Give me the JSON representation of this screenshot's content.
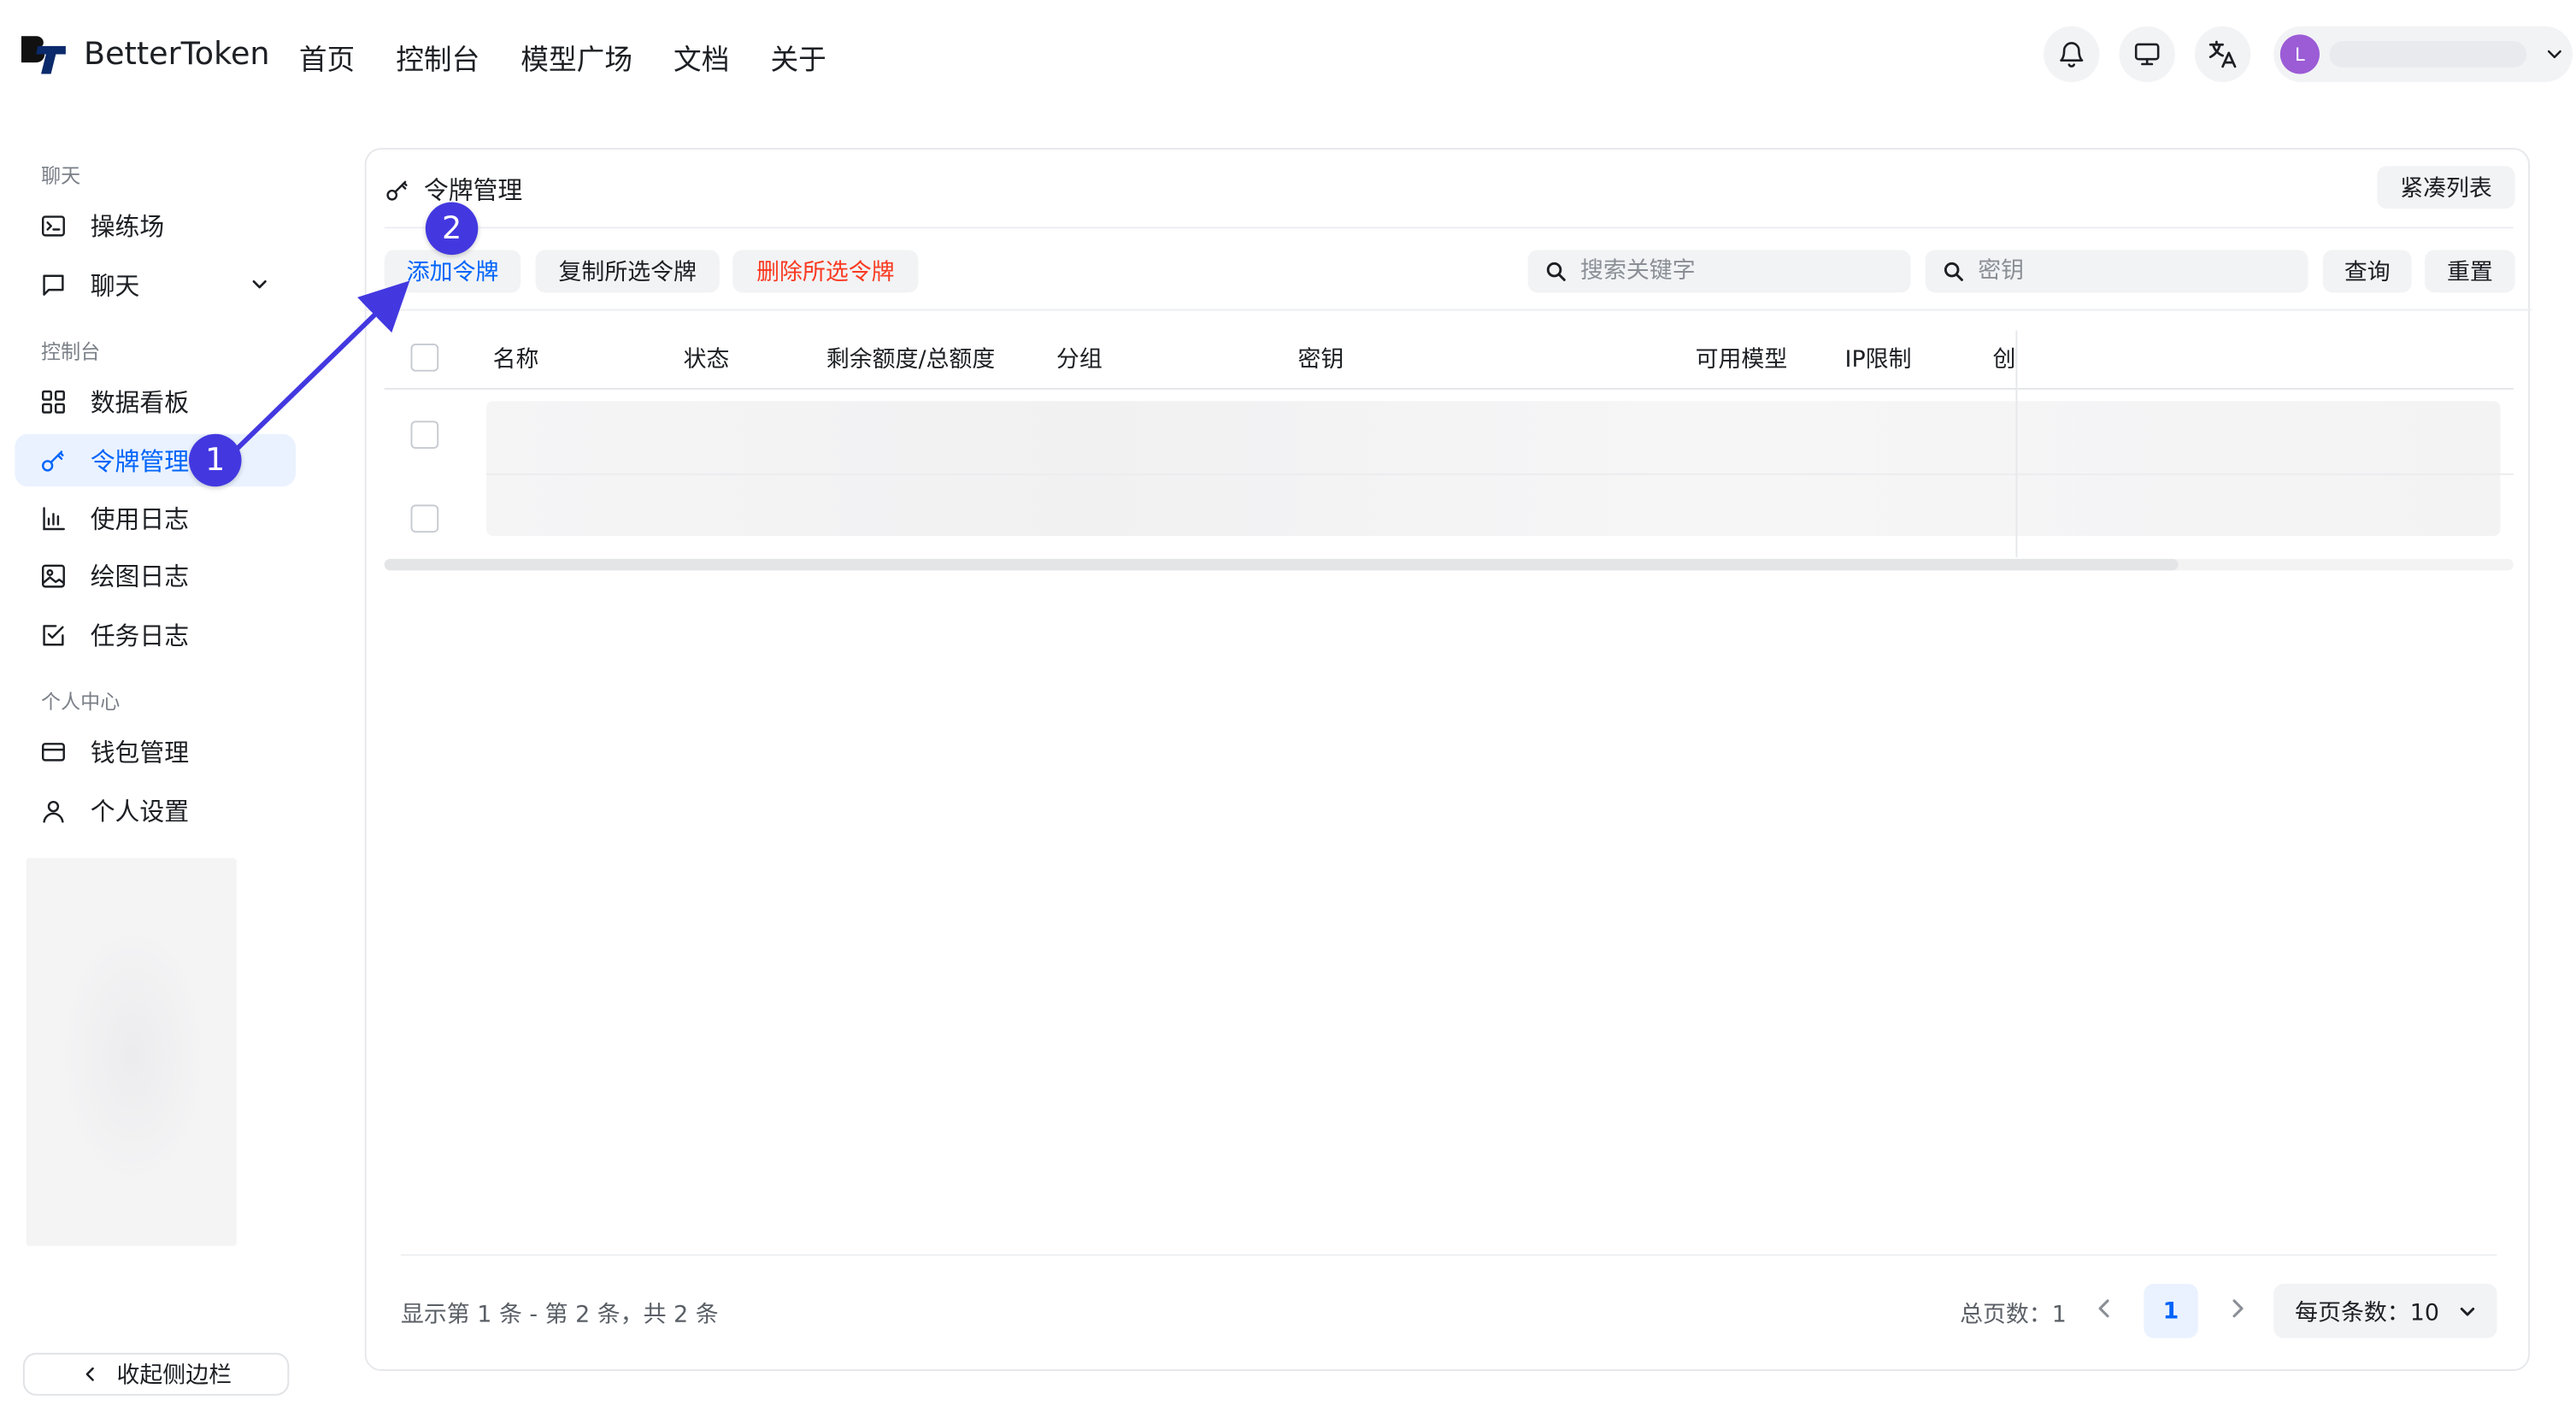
{
  "header": {
    "brand": "BetterToken",
    "nav": [
      "首页",
      "控制台",
      "模型广场",
      "文档",
      "关于"
    ],
    "avatar_initial": "L",
    "icons": [
      "bell-icon",
      "monitor-icon",
      "translate-icon"
    ]
  },
  "sidebar": {
    "sections": [
      {
        "title": "聊天",
        "items": [
          {
            "label": "操练场",
            "icon": "terminal-icon"
          },
          {
            "label": "聊天",
            "icon": "chat-icon"
          }
        ]
      },
      {
        "title": "控制台",
        "items": [
          {
            "label": "数据看板",
            "icon": "dashboard-icon"
          },
          {
            "label": "令牌管理",
            "icon": "key-icon",
            "active": true
          },
          {
            "label": "使用日志",
            "icon": "bar-chart-icon"
          },
          {
            "label": "绘图日志",
            "icon": "image-icon"
          },
          {
            "label": "任务日志",
            "icon": "task-icon"
          }
        ]
      },
      {
        "title": "个人中心",
        "items": [
          {
            "label": "钱包管理",
            "icon": "wallet-icon"
          },
          {
            "label": "个人设置",
            "icon": "user-icon"
          }
        ]
      }
    ],
    "collapse_label": "收起侧边栏"
  },
  "main": {
    "title": "令牌管理",
    "compact_label": "紧凑列表",
    "toolbar": {
      "add": "添加令牌",
      "copy": "复制所选令牌",
      "delete": "删除所选令牌",
      "search_placeholder": "搜索关键字",
      "key_placeholder": "密钥",
      "query": "查询",
      "reset": "重置"
    },
    "columns": [
      "名称",
      "状态",
      "剩余额度/总额度",
      "分组",
      "密钥",
      "可用模型",
      "IP限制",
      "创"
    ],
    "row_count": 2,
    "footer": {
      "info": "显示第 1 条 - 第 2 条，共 2 条",
      "total_pages": "总页数：1",
      "current_page": "1",
      "page_size": "每页条数：10"
    }
  },
  "annotations": [
    "1",
    "2"
  ],
  "colors": {
    "accent": "#0064fa",
    "danger": "#f93920",
    "annotation": "#4338e0",
    "active_bg": "#eaf2ff"
  }
}
